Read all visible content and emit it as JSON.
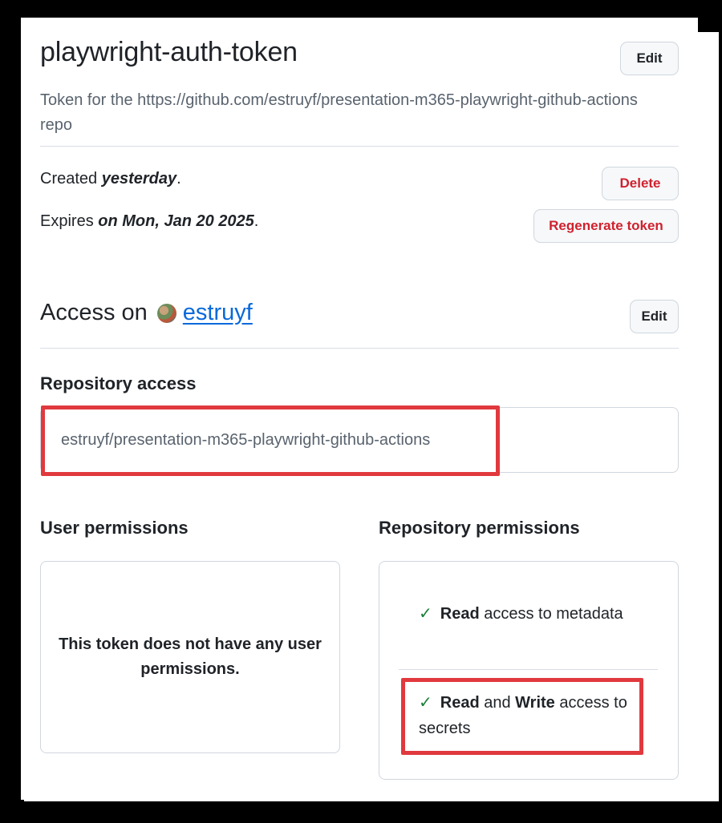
{
  "token": {
    "name": "playwright-auth-token",
    "edit_label": "Edit",
    "description": "Token for the https://github.com/estruyf/presentation-m365-playwright-github-actions repo",
    "created_prefix": "Created ",
    "created_value": "yesterday",
    "created_suffix": ".",
    "expires_prefix": "Expires ",
    "expires_value": "on Mon, Jan 20 2025",
    "expires_suffix": ".",
    "delete_label": "Delete",
    "regenerate_label": "Regenerate token"
  },
  "access": {
    "prefix": "Access on",
    "owner": "estruyf",
    "edit_label": "Edit"
  },
  "repository_access": {
    "heading": "Repository access",
    "repo": "estruyf/presentation-m365-playwright-github-actions"
  },
  "user_permissions": {
    "heading": "User permissions",
    "empty_message": "This token does not have any user permissions."
  },
  "repository_permissions": {
    "heading": "Repository permissions",
    "items": [
      {
        "strong1": "Read",
        "rest1": " access to metadata"
      },
      {
        "strong1": "Read",
        "mid": " and ",
        "strong2": "Write",
        "rest2": " access to secrets"
      }
    ]
  },
  "colors": {
    "danger": "#cf222e",
    "link": "#0969da",
    "success": "#1a7f37",
    "highlight": "#e0393e"
  },
  "icons": [
    "check-icon",
    "avatar-icon"
  ]
}
